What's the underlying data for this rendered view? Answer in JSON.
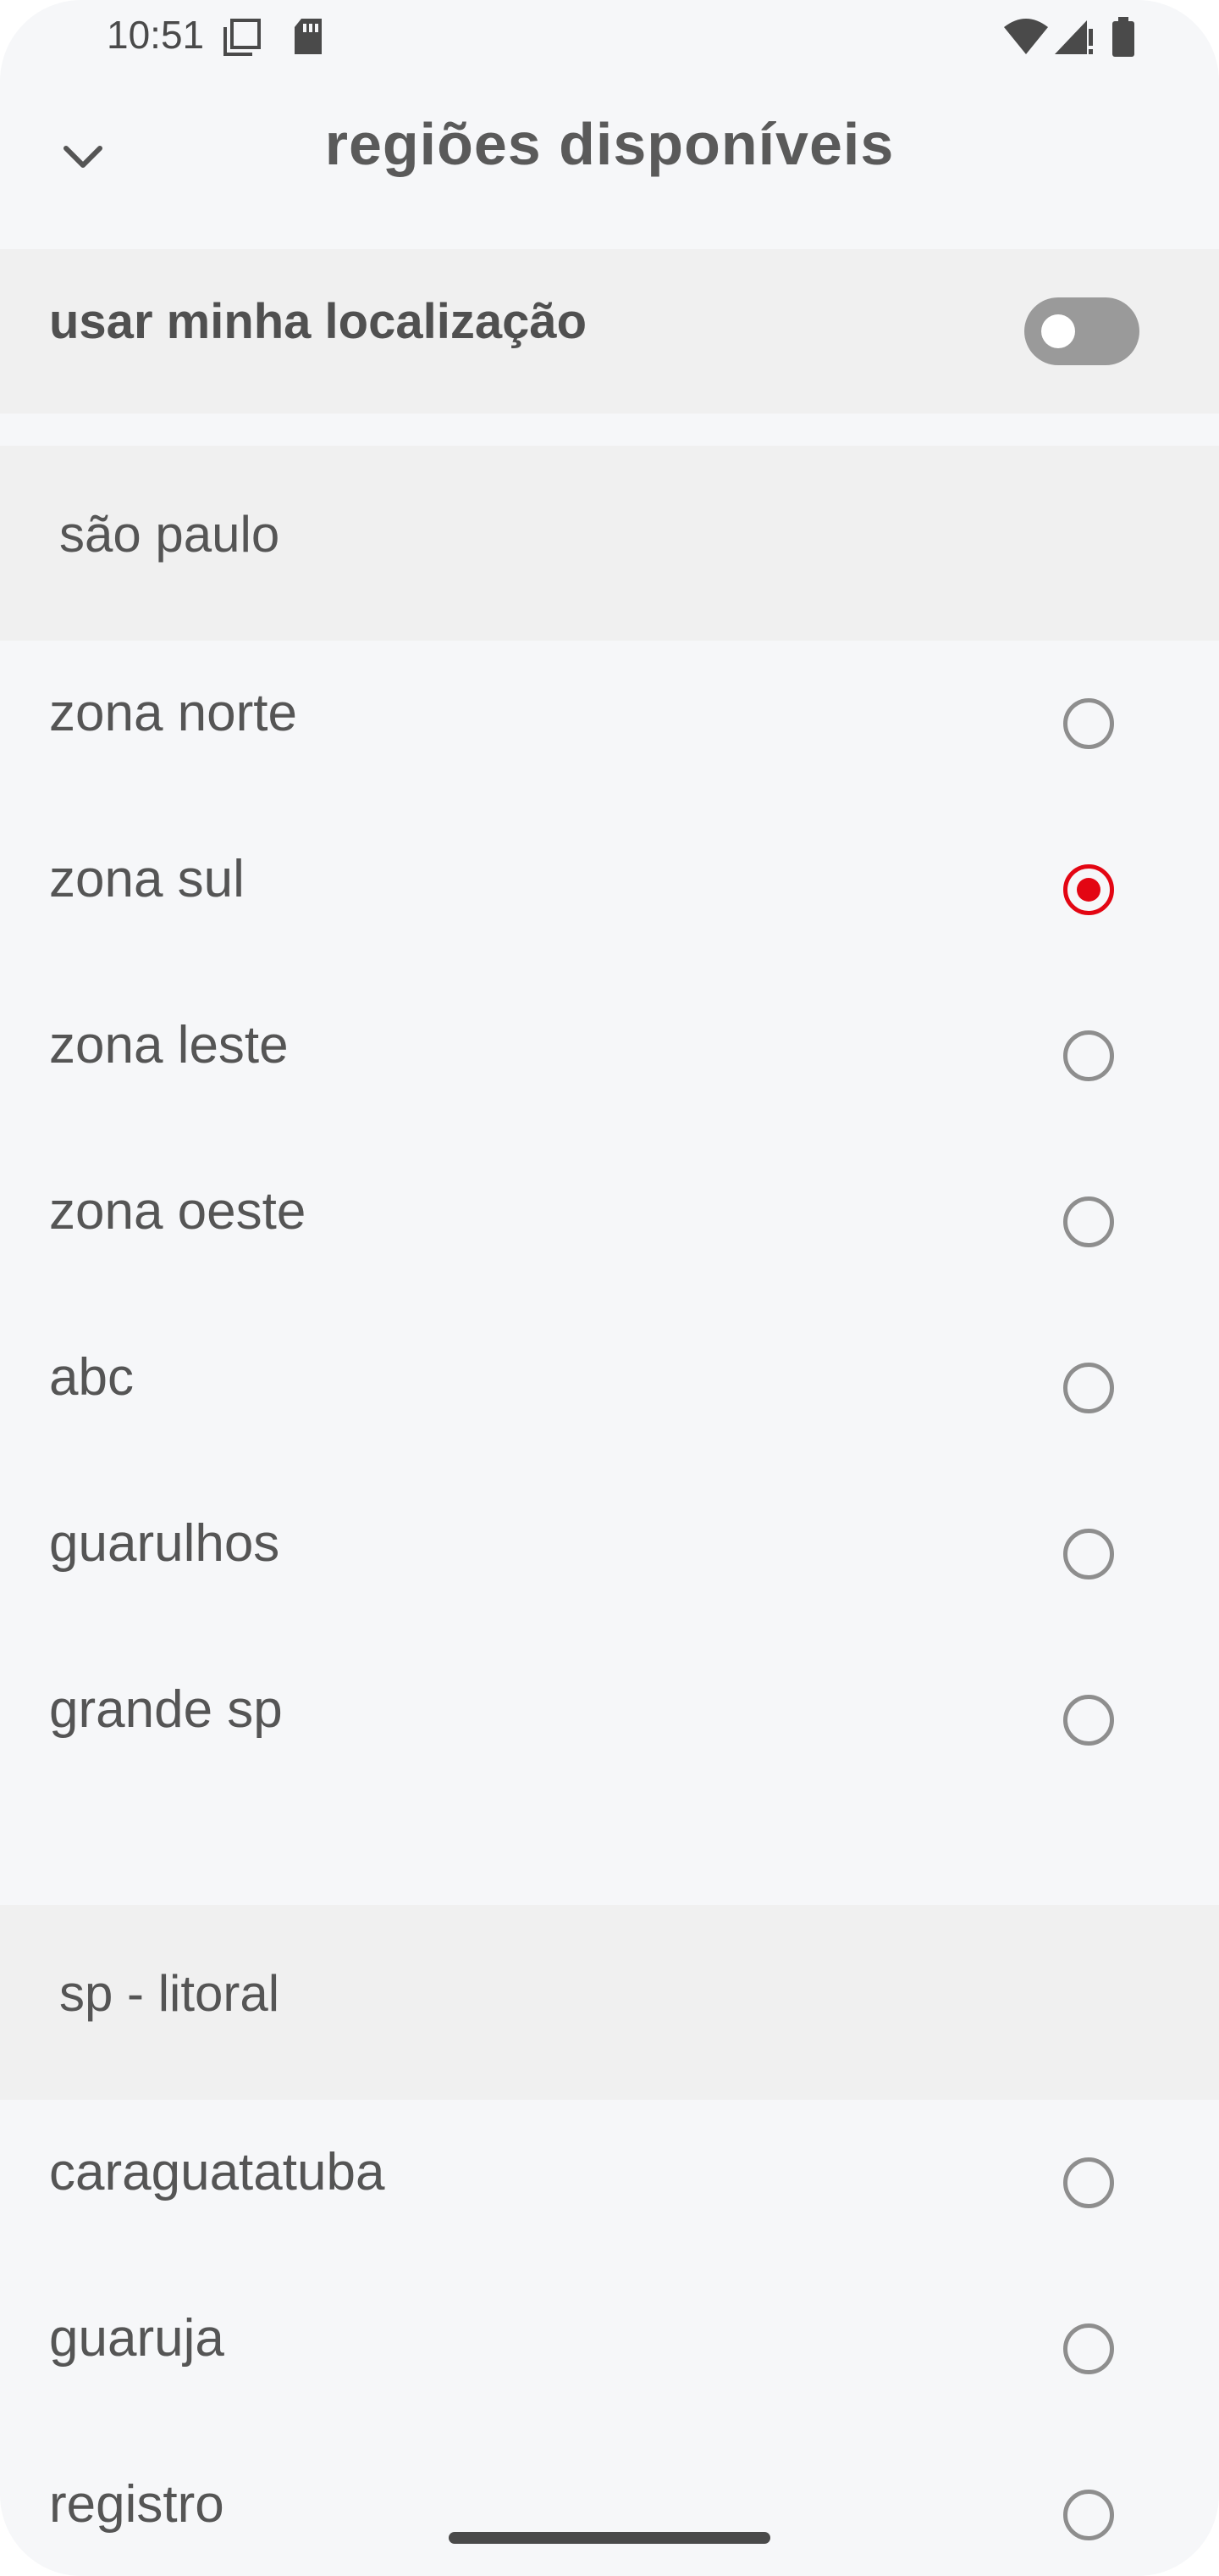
{
  "status_bar": {
    "time": "10:51",
    "icons": [
      "copy-icon",
      "sd-card-icon",
      "wifi-icon",
      "signal-icon",
      "battery-icon"
    ]
  },
  "app_bar": {
    "back_icon": "chevron-down-icon",
    "title": "regiões disponíveis"
  },
  "location": {
    "label": "usar minha localização",
    "enabled": false
  },
  "sections": [
    {
      "title": "são paulo",
      "items": [
        {
          "label": "zona norte",
          "selected": false
        },
        {
          "label": "zona sul",
          "selected": true
        },
        {
          "label": "zona leste",
          "selected": false
        },
        {
          "label": "zona oeste",
          "selected": false
        },
        {
          "label": "abc",
          "selected": false
        },
        {
          "label": "guarulhos",
          "selected": false
        },
        {
          "label": "grande sp",
          "selected": false
        }
      ]
    },
    {
      "title": "sp - litoral",
      "items": [
        {
          "label": "caraguatatuba",
          "selected": false
        },
        {
          "label": "guaruja",
          "selected": false
        },
        {
          "label": "registro",
          "selected": false
        }
      ]
    }
  ],
  "colors": {
    "accent": "#e30613",
    "background": "#f6f7f9",
    "section_bg": "#f0f0f0",
    "text": "#555555"
  }
}
